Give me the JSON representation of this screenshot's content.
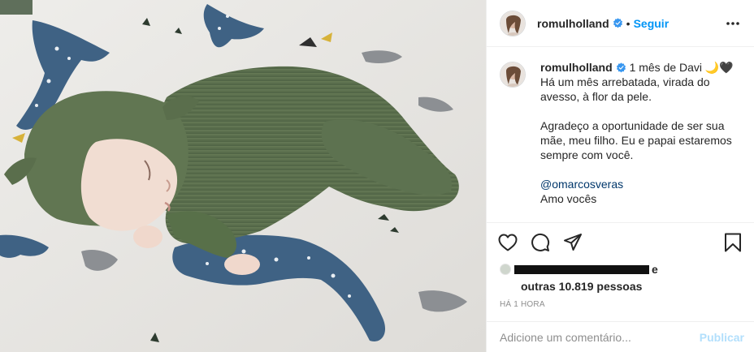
{
  "post": {
    "username": "romulholland",
    "follow_label": "Seguir",
    "dot": "•",
    "caption": {
      "title": "1 mês de Davi 🌙🖤",
      "paragraph1": "Há um mês arrebatada, virada do avesso, à flor da pele.",
      "paragraph2": "Agradeço a oportunidade de ser sua mãe, meu filho. Eu e papai estaremos sempre com você.",
      "mention": "@omarcosveras",
      "closing": "Amo vocês"
    },
    "likes": {
      "tail": "e",
      "others": "outras 10.819 pessoas"
    },
    "timestamp": "HÁ 1 HORA",
    "comment": {
      "placeholder": "Adicione um comentário...",
      "publish_label": "Publicar"
    }
  },
  "icons": {
    "verified": "verified-badge-icon",
    "more": "more-horizontal-icon",
    "like": "heart-icon",
    "comment": "comment-bubble-icon",
    "share": "share-paper-plane-icon",
    "save": "bookmark-icon"
  },
  "colors": {
    "link_blue": "#0095f6",
    "publish_disabled": "#b2dffc",
    "text": "#262626",
    "muted": "#8e8e8e",
    "mention": "#00376b"
  }
}
